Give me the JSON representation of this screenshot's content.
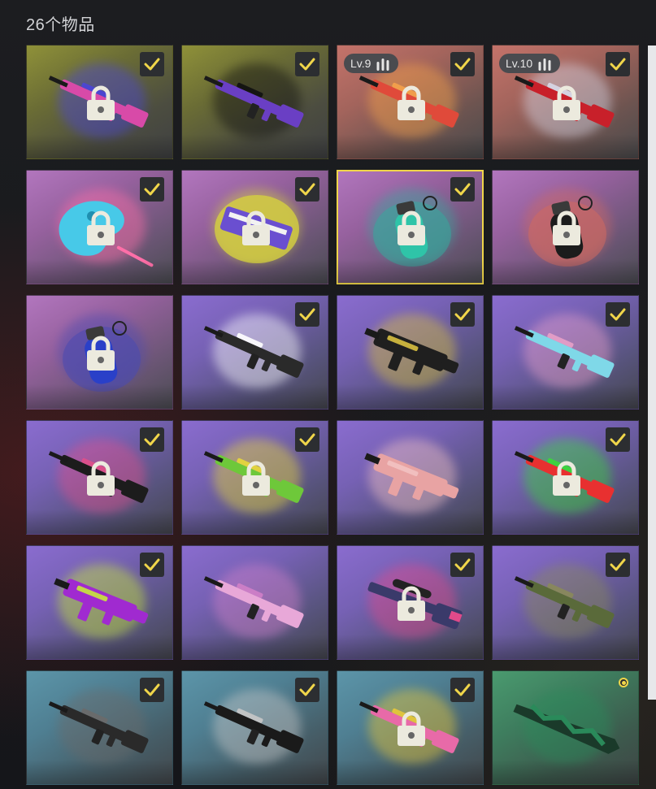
{
  "inventory": {
    "title": "26个物品",
    "items": [
      {
        "rarity": "yellow",
        "kind": "rifle",
        "checked": true,
        "locked": true,
        "accent": "#d84aa8",
        "splash": "#4a45d8"
      },
      {
        "rarity": "yellow",
        "kind": "rifle",
        "checked": true,
        "locked": false,
        "accent": "#6a3fc4",
        "splash": "#111111"
      },
      {
        "rarity": "orange",
        "kind": "rifle",
        "checked": true,
        "locked": true,
        "level": "Lv.9",
        "accent": "#e04a3a",
        "splash": "#f5a24a"
      },
      {
        "rarity": "orange",
        "kind": "rifle",
        "checked": true,
        "locked": true,
        "level": "Lv.10",
        "accent": "#c8202a",
        "splash": "#d8d8e8"
      },
      {
        "rarity": "pink",
        "kind": "palette",
        "checked": true,
        "locked": true,
        "accent": "#47c9e8",
        "splash": "#ff6fa8"
      },
      {
        "rarity": "pink",
        "kind": "package",
        "checked": true,
        "locked": true,
        "accent": "#6a4fd0",
        "splash": "#d4d040"
      },
      {
        "rarity": "pink",
        "kind": "grenade",
        "checked": true,
        "locked": true,
        "selected": true,
        "accent": "#2fc4a8",
        "splash": "#37a89c"
      },
      {
        "rarity": "pink",
        "kind": "grenade",
        "checked": false,
        "locked": true,
        "accent": "#1c1c1c",
        "splash": "#d06a60"
      },
      {
        "rarity": "pink",
        "kind": "grenade",
        "checked": false,
        "locked": true,
        "accent": "#2a40c8",
        "splash": "#4a4ab0"
      },
      {
        "rarity": "purple",
        "kind": "rifle",
        "checked": true,
        "locked": false,
        "accent": "#2a2a2a",
        "splash": "#ffffff"
      },
      {
        "rarity": "purple",
        "kind": "smg",
        "checked": true,
        "locked": false,
        "accent": "#1f1f1f",
        "splash": "#d8c040"
      },
      {
        "rarity": "purple",
        "kind": "rifle",
        "checked": true,
        "locked": false,
        "accent": "#7fd8e8",
        "splash": "#e8a0c8"
      },
      {
        "rarity": "purple",
        "kind": "rifle",
        "checked": true,
        "locked": true,
        "accent": "#1c1c1c",
        "splash": "#e0508a"
      },
      {
        "rarity": "purple",
        "kind": "rifle",
        "checked": true,
        "locked": true,
        "accent": "#6ec83a",
        "splash": "#e8d83a"
      },
      {
        "rarity": "purple",
        "kind": "smg",
        "checked": false,
        "locked": false,
        "accent": "#e8a3a3",
        "splash": "#f2c2c2"
      },
      {
        "rarity": "purple",
        "kind": "rifle",
        "checked": true,
        "locked": true,
        "accent": "#e83030",
        "splash": "#3ad83a"
      },
      {
        "rarity": "purple",
        "kind": "smg",
        "checked": true,
        "locked": false,
        "accent": "#a02ad0",
        "splash": "#c8e83a"
      },
      {
        "rarity": "purple",
        "kind": "rifle",
        "checked": false,
        "locked": false,
        "accent": "#e8a8d8",
        "splash": "#d080c8"
      },
      {
        "rarity": "purple",
        "kind": "sniper",
        "checked": true,
        "locked": true,
        "accent": "#3a3a6a",
        "splash": "#e04a8a"
      },
      {
        "rarity": "purple",
        "kind": "rifle",
        "checked": true,
        "locked": false,
        "accent": "#5a6a3a",
        "splash": "#8a8a5a"
      },
      {
        "rarity": "blue",
        "kind": "rifle",
        "checked": true,
        "locked": false,
        "accent": "#2a2a2a",
        "splash": "#6a6a6a"
      },
      {
        "rarity": "blue",
        "kind": "rifle",
        "checked": true,
        "locked": false,
        "accent": "#1a1a1a",
        "splash": "#c8c8c8"
      },
      {
        "rarity": "blue",
        "kind": "rifle",
        "checked": true,
        "locked": true,
        "accent": "#e86aa8",
        "splash": "#e8c83a"
      },
      {
        "rarity": "green",
        "kind": "sheath",
        "checked": false,
        "locked": false,
        "radio": true,
        "accent": "#1a3a2a",
        "splash": "#2a8a5a"
      }
    ]
  },
  "icons": {
    "check": "checkmark-icon",
    "lock": "lock-icon",
    "level": "bullets-icon",
    "radio": "radio-icon"
  },
  "colors": {
    "accent": "#f0d64a",
    "check": "#f0d64a",
    "title": "#d2d3d6"
  }
}
